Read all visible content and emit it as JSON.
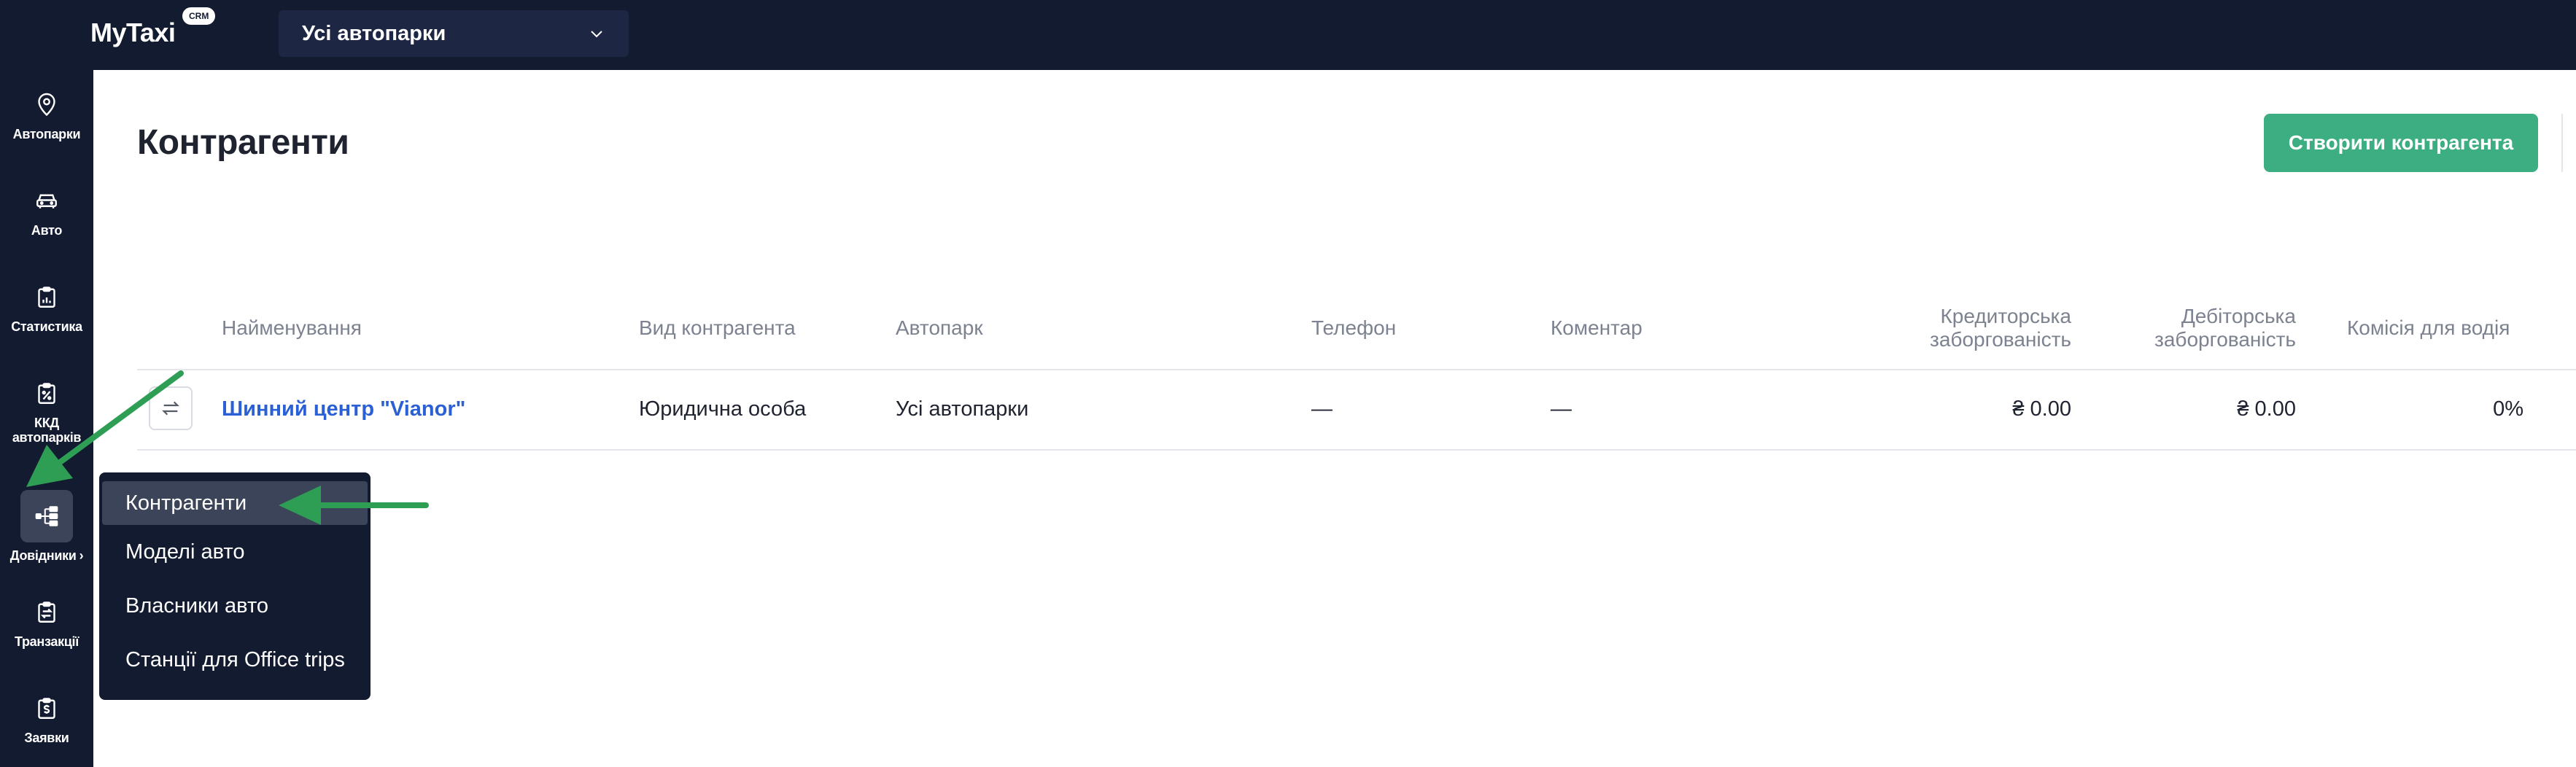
{
  "header": {
    "logo_text": "MyTaxi",
    "badge": "CRM",
    "fleet_selector": "Усі автопарки"
  },
  "sidebar": {
    "items": [
      {
        "label": "Автопарки",
        "icon": "map-pin-icon"
      },
      {
        "label": "Авто",
        "icon": "car-icon"
      },
      {
        "label": "Статистика",
        "icon": "clipboard-chart-icon"
      },
      {
        "label": "ККД автопарків",
        "icon": "percent-document-icon"
      },
      {
        "label": "Довідники",
        "icon": "hierarchy-icon",
        "active": true
      },
      {
        "label": "Транзакції",
        "icon": "clipboard-exchange-icon"
      },
      {
        "label": "Заявки",
        "icon": "clipboard-money-icon"
      }
    ]
  },
  "page": {
    "title": "Контрагенти",
    "create_button": "Створити контрагента"
  },
  "table": {
    "columns": {
      "name": "Найменування",
      "type": "Вид контрагента",
      "fleet": "Автопарк",
      "phone": "Телефон",
      "comment": "Коментар",
      "credit_line1": "Кредиторська",
      "credit_line2": "заборгованість",
      "debit_line1": "Дебіторська",
      "debit_line2": "заборгованість",
      "commission": "Комісія для водія"
    },
    "rows": [
      {
        "name": "Шинний центр \"Vianor\"",
        "type": "Юридична особа",
        "fleet": "Усі автопарки",
        "phone": "—",
        "comment": "—",
        "credit": "₴ 0.00",
        "debit": "₴ 0.00",
        "commission": "0%"
      }
    ]
  },
  "menu": {
    "items": [
      {
        "label": "Контрагенти",
        "active": true
      },
      {
        "label": "Моделі авто"
      },
      {
        "label": "Власники авто"
      },
      {
        "label": "Станції для Office trips"
      }
    ]
  },
  "colors": {
    "navy": "#131b31",
    "accent_green": "#3dae82",
    "link_blue": "#2b60d4",
    "annotation_green": "#2f9e55"
  }
}
